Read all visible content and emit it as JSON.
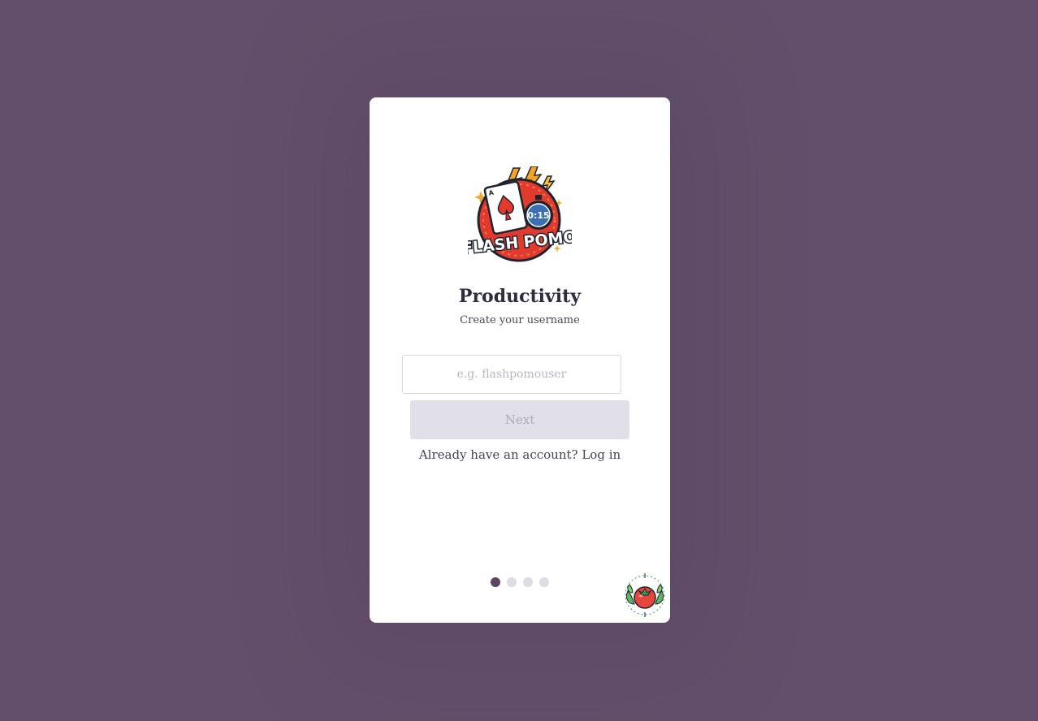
{
  "brand": {
    "logo_text": "FLASH POMO",
    "timer_text": "0:15"
  },
  "screen": {
    "title": "Productivity",
    "subtitle": "Create your username"
  },
  "username": {
    "value": "",
    "placeholder": "e.g. flashpomouser"
  },
  "next_label": "Next",
  "login": {
    "prompt": "Already have an account?",
    "link_label": "Log in"
  },
  "pagination": {
    "total": 4,
    "current": 1
  },
  "colors": {
    "background": "#634f6b",
    "card": "#ffffff",
    "dot_active": "#5b4763",
    "dot_inactive": "#dedbe4",
    "button_disabled": "#e1dfe8"
  }
}
